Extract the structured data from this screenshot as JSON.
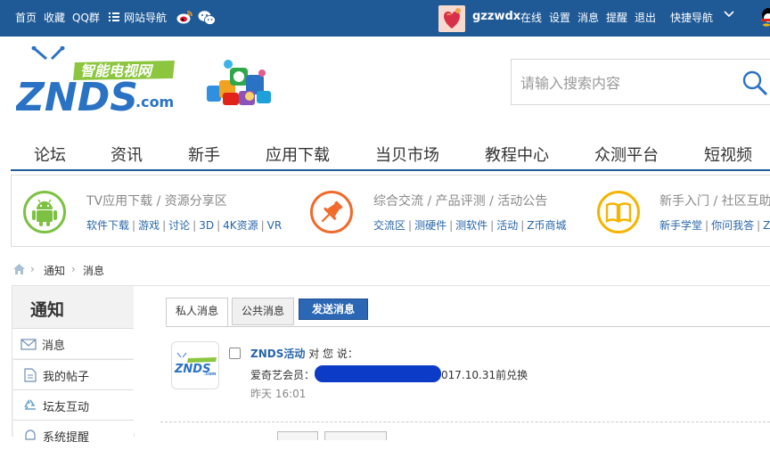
{
  "topbar": {
    "links": [
      "首页",
      "收藏",
      "QQ群"
    ],
    "site_nav": "网站导航",
    "username": "gzzwdx",
    "status_links": [
      "在线",
      "设置",
      "消息",
      "提醒",
      "退出"
    ],
    "quick_nav": "快捷导航",
    "colors": {
      "bar": "#1f5a96"
    }
  },
  "header": {
    "logo_text": "ZNDS",
    "logo_suffix": ".com",
    "logo_tagline": "智能电视网",
    "search_placeholder": "请输入搜索内容"
  },
  "nav": [
    "论坛",
    "资讯",
    "新手",
    "应用下载",
    "当贝市场",
    "教程中心",
    "众测平台",
    "短视频"
  ],
  "categories": [
    {
      "title": "TV应用下载 / 资源分享区",
      "links": [
        "软件下载",
        "游戏",
        "讨论",
        "3D",
        "4K资源",
        "VR"
      ],
      "color": "#7dc142",
      "icon": "android-icon"
    },
    {
      "title": "综合交流 / 产品评测 / 活动公告",
      "links": [
        "交流区",
        "测硬件",
        "测软件",
        "活动",
        "Z币商城"
      ],
      "color": "#f06b2b",
      "icon": "pin-icon"
    },
    {
      "title": "新手入门 / 社区互助",
      "links": [
        "新手学堂",
        "你问我答",
        "Z"
      ],
      "color": "#f5b400",
      "icon": "book-icon"
    }
  ],
  "breadcrumb": [
    "通知",
    "消息"
  ],
  "sidebar": {
    "title": "通知",
    "items": [
      {
        "label": "消息",
        "icon": "mail-icon"
      },
      {
        "label": "我的帖子",
        "icon": "document-icon"
      },
      {
        "label": "坛友互动",
        "icon": "recycle-icon"
      },
      {
        "label": "系统提醒",
        "icon": "bell-icon"
      }
    ]
  },
  "tabs": {
    "private": "私人消息",
    "public": "公共消息",
    "send": "发送消息"
  },
  "message": {
    "sender": "ZNDS活动",
    "verb": "对 您 说：",
    "body_prefix": "爱奇艺会员：",
    "body_suffix": "017.10.31前兑换",
    "time": "昨天 16:01"
  }
}
